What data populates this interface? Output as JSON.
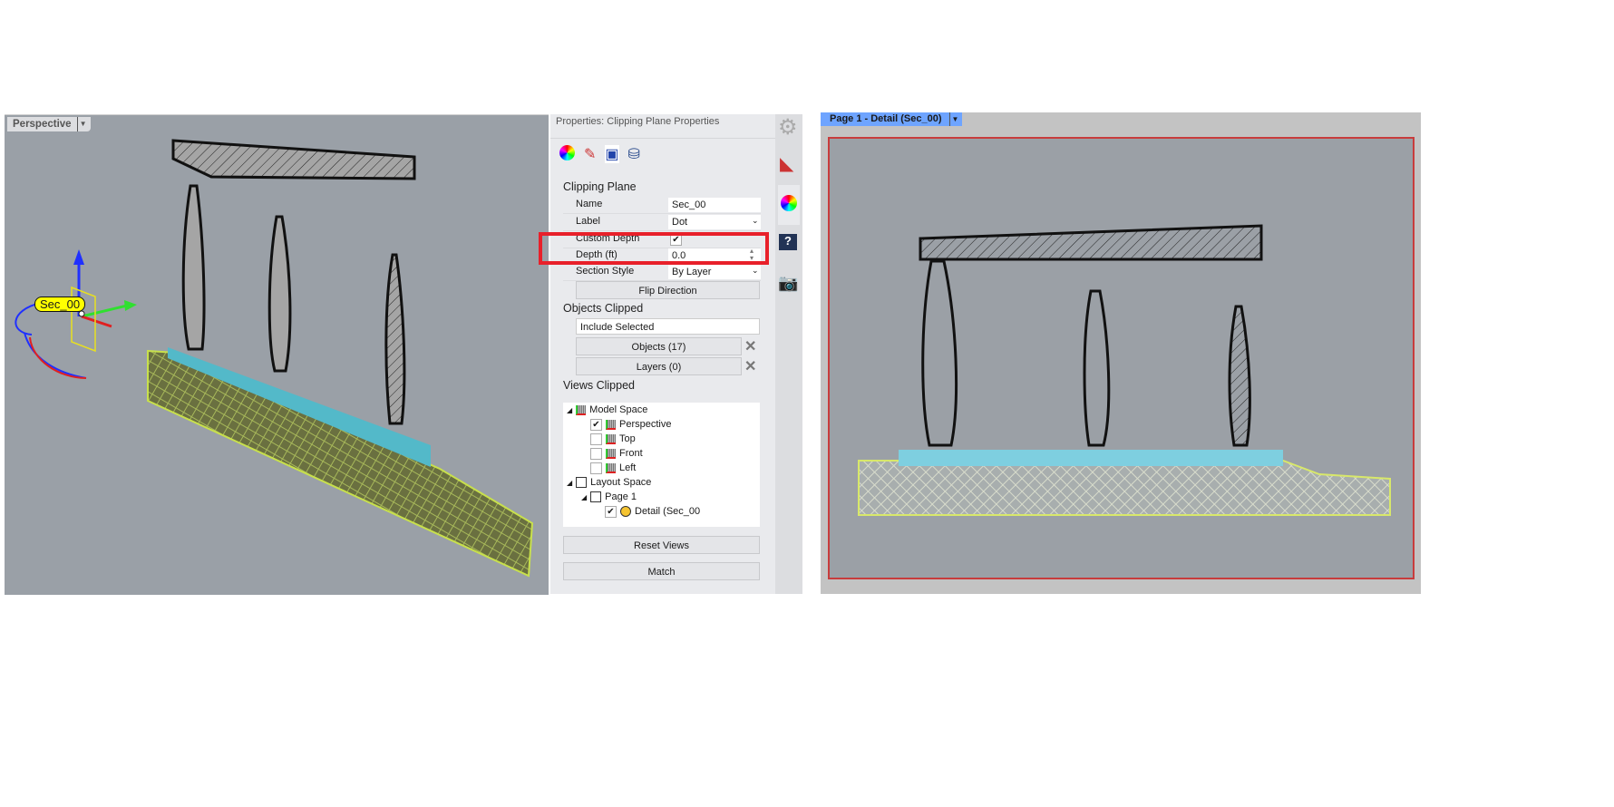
{
  "viewport": {
    "tab": "Perspective",
    "dot_label": "Sec_00"
  },
  "properties": {
    "title": "Properties: Clipping Plane Properties",
    "section_clipping": "Clipping Plane",
    "fields": [
      {
        "label": "Name",
        "value": "Sec_00"
      },
      {
        "label": "Label",
        "value": "Dot"
      },
      {
        "label": "Custom Depth",
        "value": "✔"
      },
      {
        "label": "Depth (ft)",
        "value": "0.0"
      },
      {
        "label": "Section Style",
        "value": "By Layer"
      }
    ],
    "flip_button": "Flip Direction",
    "section_objects": "Objects Clipped",
    "objects_mode": "Include Selected",
    "objects_button": "Objects (17)",
    "layers_button": "Layers (0)",
    "section_views": "Views Clipped",
    "tree": {
      "model_space": "Model Space",
      "perspective": "Perspective",
      "top": "Top",
      "front": "Front",
      "left": "Left",
      "layout_space": "Layout Space",
      "page1": "Page 1",
      "detail": "Detail (Sec_00"
    },
    "reset_button": "Reset Views",
    "match_button": "Match"
  },
  "detail": {
    "tab": "Page 1 - Detail (Sec_00)"
  }
}
